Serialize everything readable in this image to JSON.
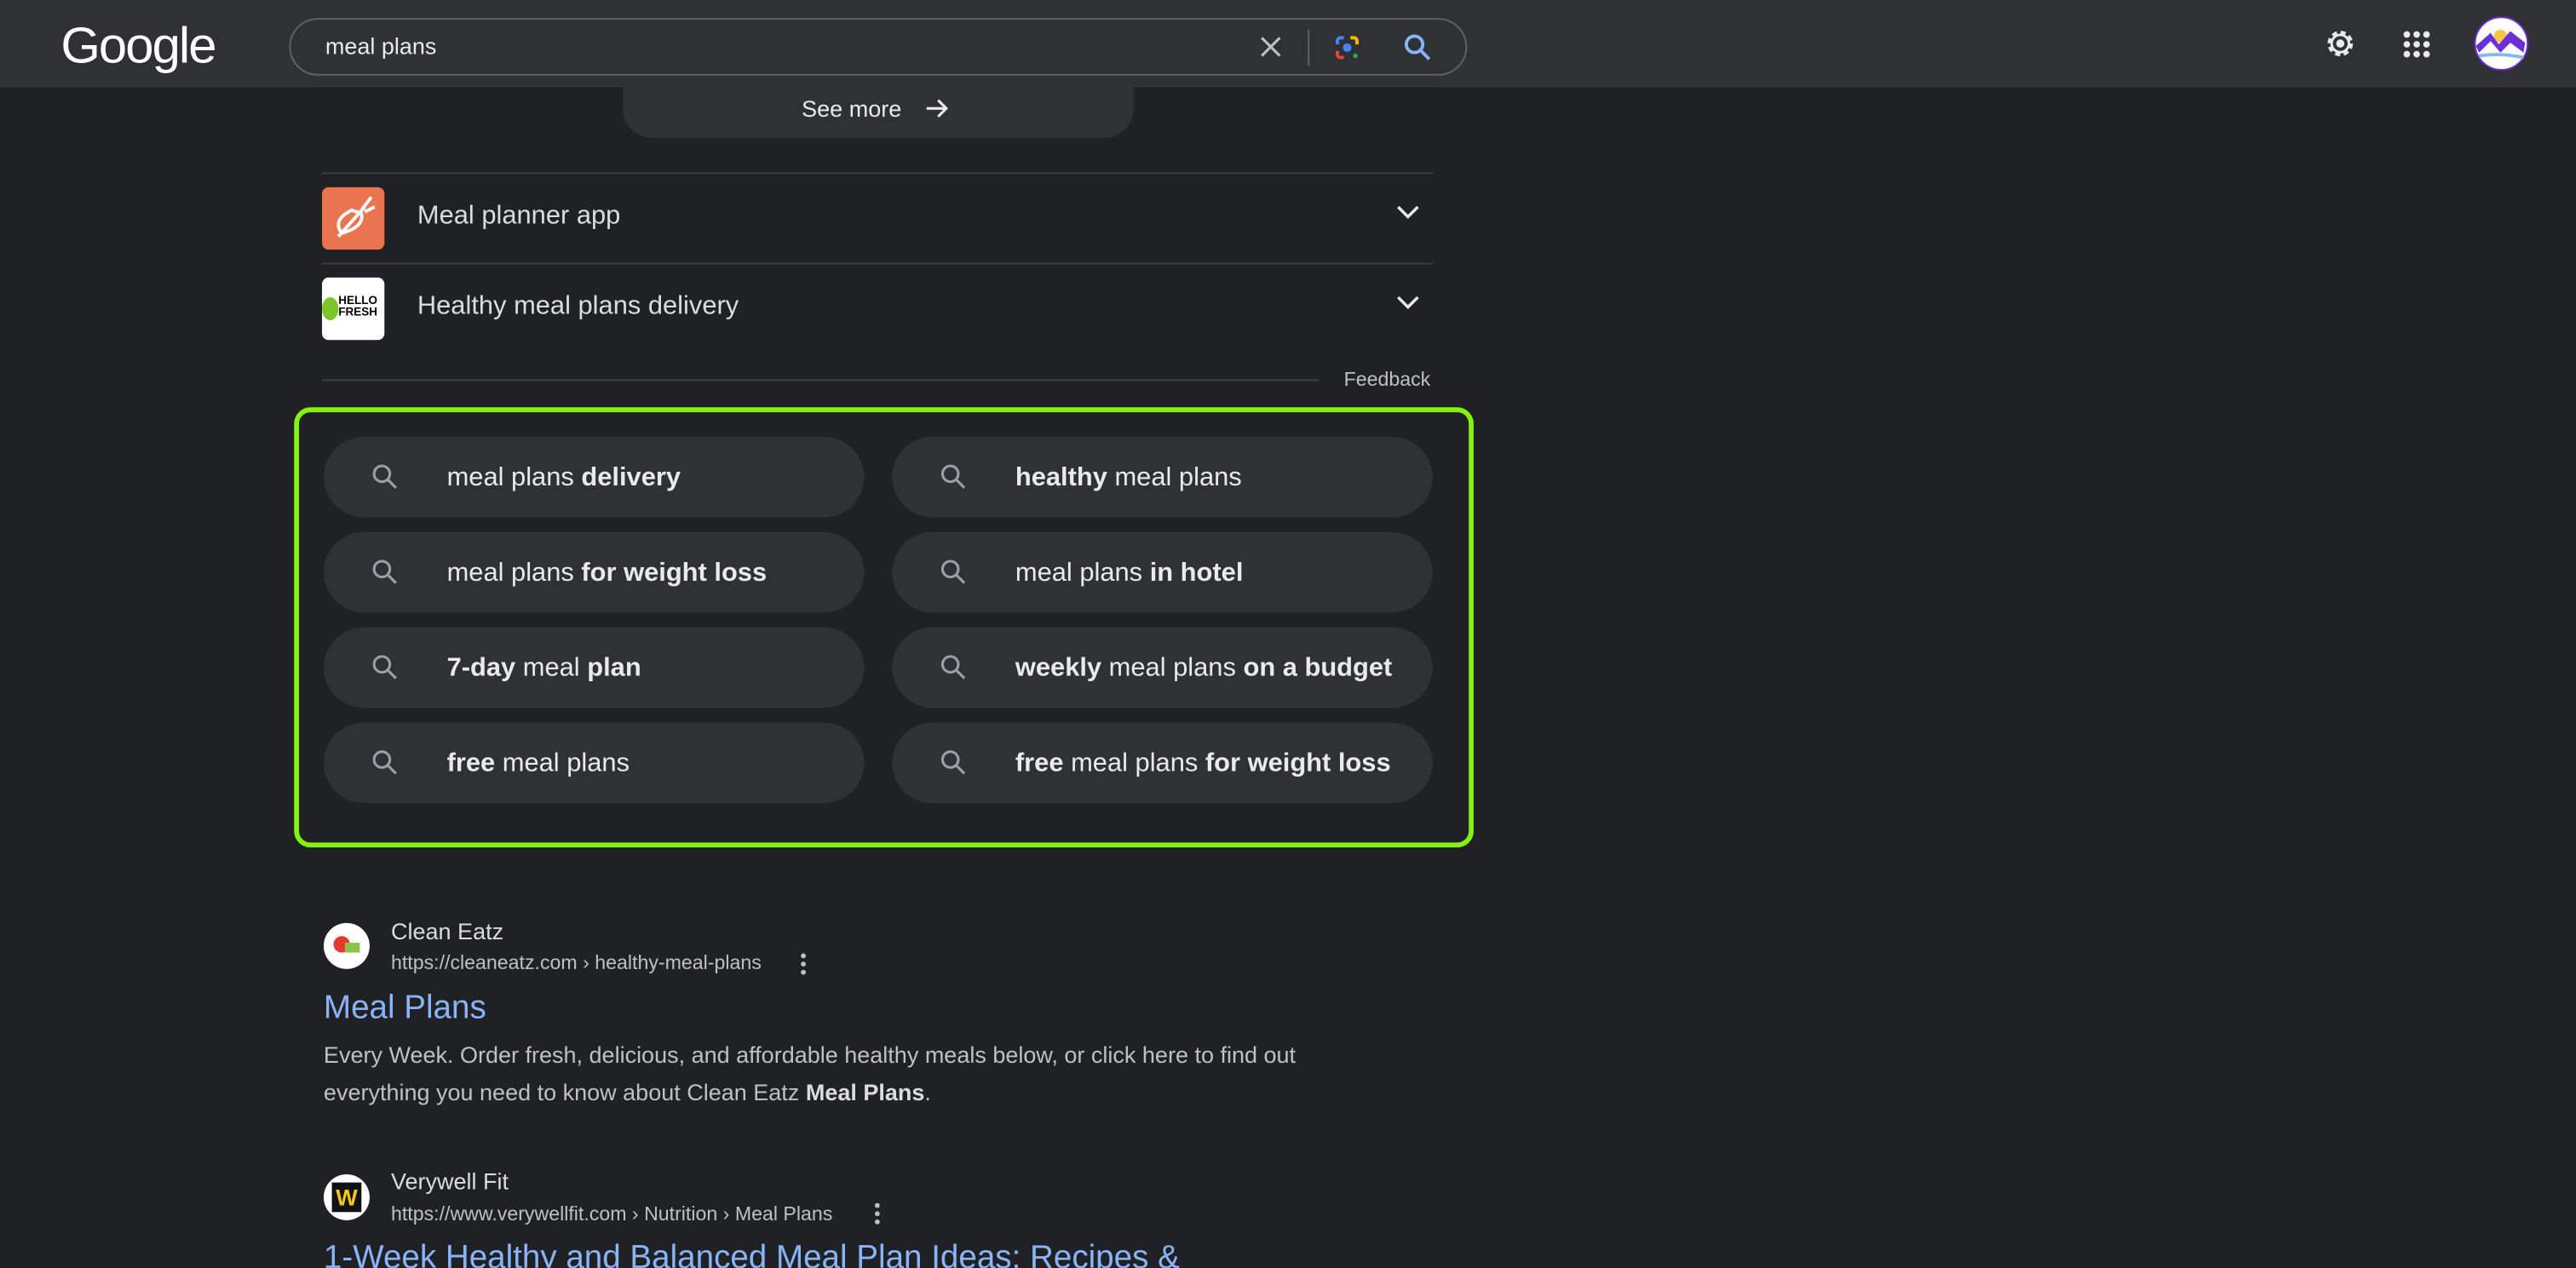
{
  "header": {
    "logo": "Google",
    "search_value": "meal plans",
    "icons": [
      "close-icon",
      "google-lens-icon",
      "search-icon",
      "settings-gear-icon",
      "apps-grid-icon",
      "avatar"
    ]
  },
  "see_more": {
    "label": "See more"
  },
  "accordion": [
    {
      "label": "Meal planner app",
      "icon_text": ""
    },
    {
      "label": "Healthy meal plans delivery",
      "icon_text": "HELLO FRESH"
    }
  ],
  "feedback": "Feedback",
  "related_searches": [
    [
      {
        "t": "meal plans ",
        "b": false
      },
      {
        "t": "delivery",
        "b": true
      }
    ],
    [
      {
        "t": "healthy",
        "b": true
      },
      {
        "t": " meal plans",
        "b": false
      }
    ],
    [
      {
        "t": "meal plans ",
        "b": false
      },
      {
        "t": "for weight loss",
        "b": true
      }
    ],
    [
      {
        "t": "meal plans ",
        "b": false
      },
      {
        "t": "in hotel",
        "b": true
      }
    ],
    [
      {
        "t": "7-day",
        "b": true
      },
      {
        "t": " meal ",
        "b": false
      },
      {
        "t": "plan",
        "b": true
      }
    ],
    [
      {
        "t": "weekly",
        "b": true
      },
      {
        "t": " meal plans ",
        "b": false
      },
      {
        "t": "on a budget",
        "b": true
      }
    ],
    [
      {
        "t": "free",
        "b": true
      },
      {
        "t": " meal plans",
        "b": false
      }
    ],
    [
      {
        "t": "free",
        "b": true
      },
      {
        "t": " meal plans ",
        "b": false
      },
      {
        "t": "for weight loss",
        "b": true
      }
    ]
  ],
  "results": [
    {
      "site": "Clean Eatz",
      "url": "https://cleaneatz.com › healthy-meal-plans",
      "title": "Meal Plans",
      "snippet": [
        {
          "t": "Every Week. Order fresh, delicious, and affordable healthy meals below, or click here to find out everything you need to know about Clean Eatz ",
          "b": false
        },
        {
          "t": "Meal Plans",
          "b": true
        },
        {
          "t": ".",
          "b": false
        }
      ]
    },
    {
      "site": "Verywell Fit",
      "url": "https://www.verywellfit.com › Nutrition › Meal Plans",
      "title": "1-Week Healthy and Balanced Meal Plan Ideas: Recipes &",
      "favicon_text": "W"
    }
  ],
  "colors": {
    "accent_link": "#8ab4f8",
    "highlight": "#84f20f",
    "chip_bg": "#303134",
    "page_bg": "#202124"
  }
}
